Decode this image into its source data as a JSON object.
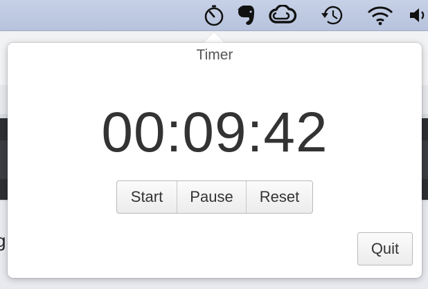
{
  "menubar": {
    "icons": [
      "timer-icon",
      "evernote-icon",
      "creative-cloud-icon",
      "time-machine-icon",
      "wifi-icon",
      "volume-icon"
    ]
  },
  "background": {
    "fragment_text": "g"
  },
  "popover": {
    "title": "Timer",
    "time": "00:09:42",
    "buttons": {
      "start": "Start",
      "pause": "Pause",
      "reset": "Reset"
    },
    "quit": "Quit"
  },
  "colors": {
    "menubar": "#c0cae2",
    "dark_band": "#2d2f33"
  }
}
